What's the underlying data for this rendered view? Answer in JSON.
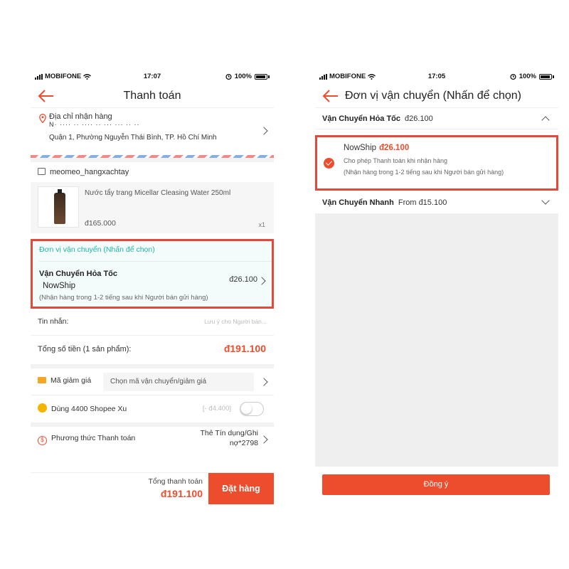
{
  "checkout": {
    "status": {
      "carrier": "MOBIFONE",
      "time": "17:07",
      "battery": "100%"
    },
    "title": "Thanh toán",
    "address": {
      "label": "Địa chỉ nhận hàng",
      "masked_line": "N· ···· ·· ···· ·· ··· ··· ·· ··",
      "street": "Quận 1, Phường Nguyễn Thái Bình, TP. Hồ Chí Minh"
    },
    "shop_name": "meomeo_hangxachtay",
    "product": {
      "name": "Nước tẩy trang Micellar Cleasing Water 250ml",
      "price": "đ165.000",
      "qty": "x1"
    },
    "shipping": {
      "hint": "Đơn vị vận chuyển (Nhấn để chọn)",
      "method": "Vận Chuyển Hỏa Tốc",
      "carrier": "NowShip",
      "price": "đ26.100",
      "note": "(Nhận hàng trong 1-2 tiếng sau khi Người bán gửi hàng)"
    },
    "message": {
      "label": "Tin nhắn:",
      "placeholder": "Lưu ý cho Người bán..."
    },
    "total": {
      "label": "Tổng số tiền (1 sản phẩm):",
      "value": "đ191.100"
    },
    "voucher": {
      "label": "Mã giảm giá",
      "placeholder": "Chọn mã vận chuyển/giảm giá"
    },
    "coins": {
      "label": "Dùng 4400 Shopee Xu",
      "value": "[- đ4.400]",
      "enabled": false
    },
    "payment": {
      "label": "Phương thức Thanh toán",
      "value_line1": "Thẻ Tín dụng/Ghi",
      "value_line2": "nợ*2798"
    },
    "bottom": {
      "label": "Tổng thanh toán",
      "value": "đ191.100",
      "order_button": "Đặt hàng"
    }
  },
  "shipping_picker": {
    "status": {
      "carrier": "MOBIFONE",
      "time": "17:05",
      "battery": "100%"
    },
    "title": "Đơn vị vận chuyển (Nhấn để chọn)",
    "express": {
      "name": "Vận Chuyển Hỏa Tốc",
      "price": "đ26.100"
    },
    "nowship": {
      "name": "NowShip",
      "price": "đ26.100",
      "sub1": "Cho phép Thanh toán khi nhận hàng",
      "sub2": "(Nhận hàng trong 1-2 tiếng sau khi Người bán gửi hàng)",
      "selected": true
    },
    "fast": {
      "name": "Vận Chuyển Nhanh",
      "from": "From đ15.100"
    },
    "agree_button": "Đồng ý"
  },
  "colors": {
    "accent": "#ee4d2d",
    "teal": "#20b5a4",
    "highlight_border": "#e2493a"
  },
  "icons": [
    "signal-icon",
    "wifi-icon",
    "alarm-icon",
    "battery-icon",
    "back-arrow-icon",
    "location-pin-icon",
    "store-icon",
    "chevron-right-icon",
    "voucher-icon",
    "coin-icon",
    "payment-icon",
    "check-icon",
    "chevron-up-icon",
    "chevron-down-icon"
  ]
}
